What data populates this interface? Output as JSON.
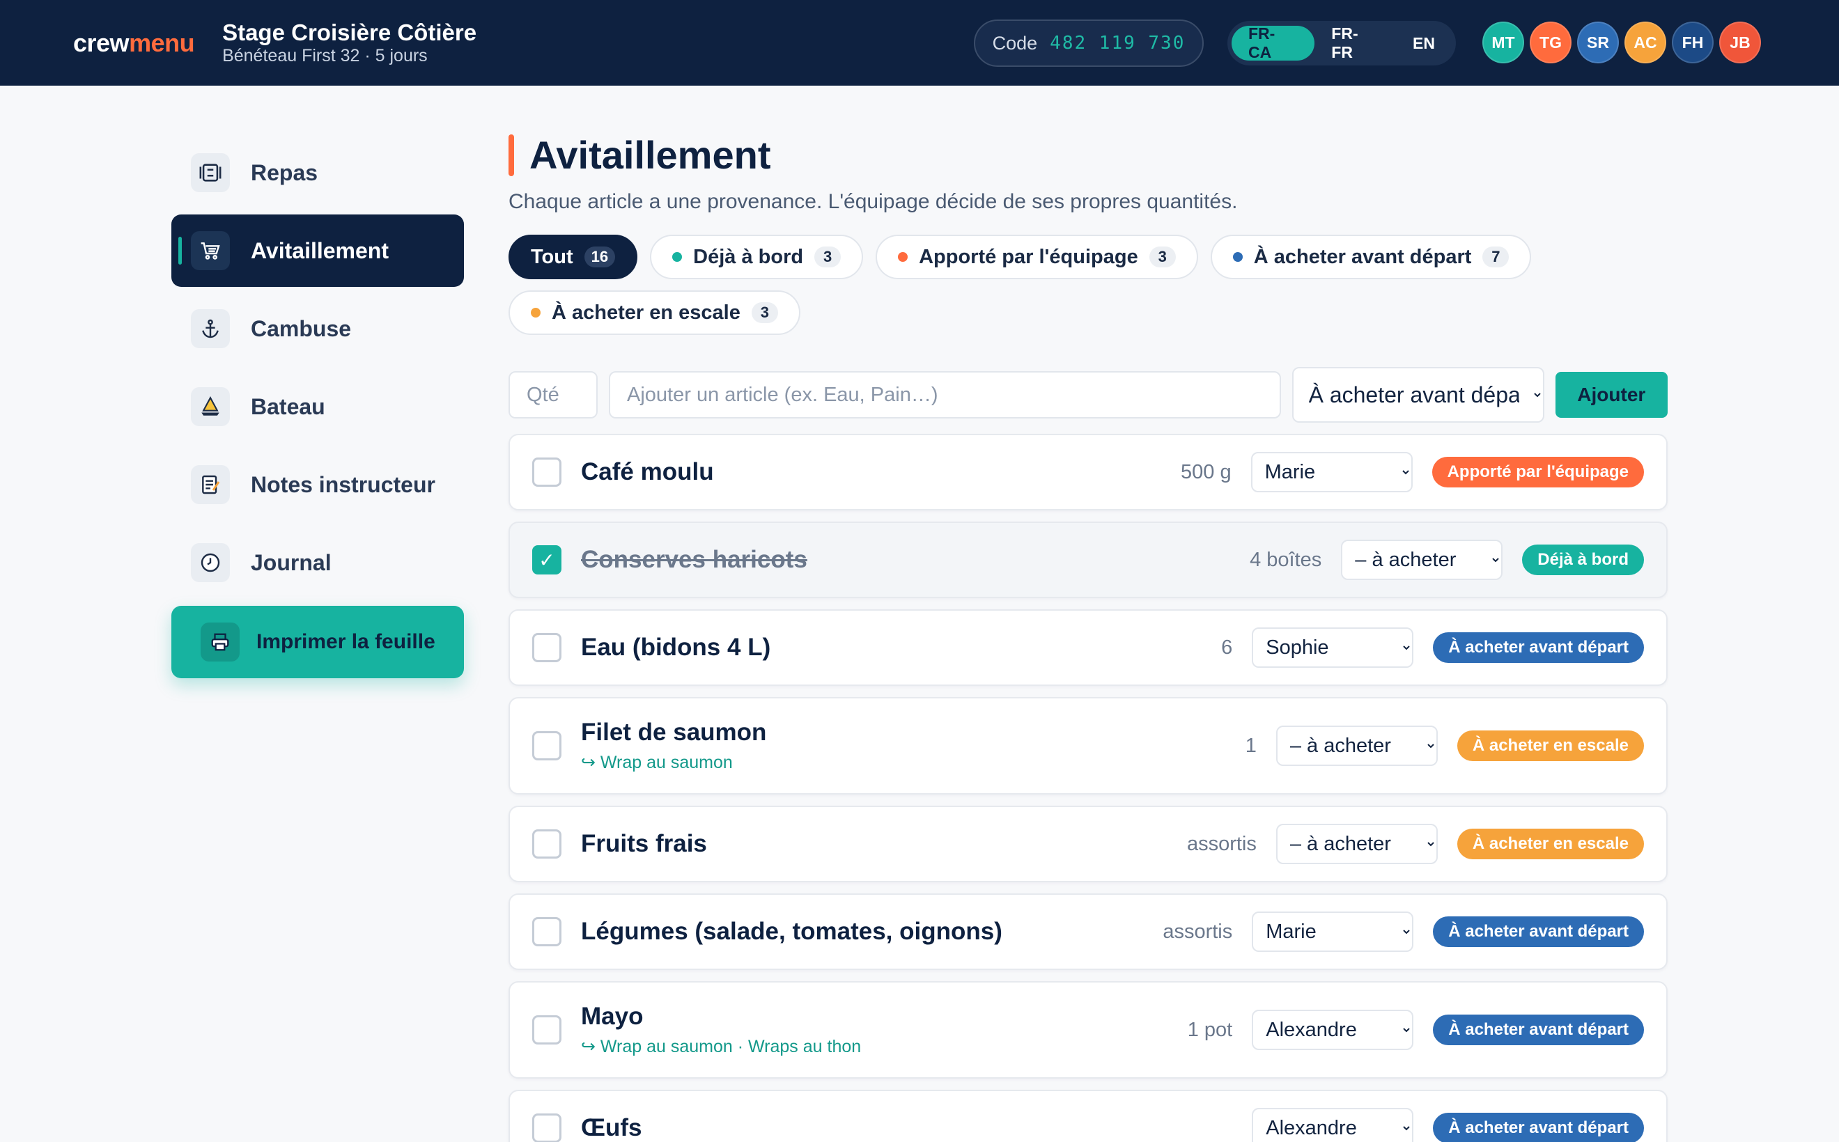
{
  "brand": {
    "logo_part1": "crew",
    "logo_part2": "menu"
  },
  "trip": {
    "title": "Stage Croisière Côtière",
    "subtitle": "Bénéteau First 32 · 5 jours"
  },
  "code": {
    "label": "Code",
    "value": "482 119 730"
  },
  "languages": [
    {
      "label": "FR-CA",
      "active": true
    },
    {
      "label": "FR-FR",
      "active": false
    },
    {
      "label": "EN",
      "active": false
    }
  ],
  "avatars": [
    {
      "initials": "MT",
      "color": "#17b3a0"
    },
    {
      "initials": "TG",
      "color": "#ff6b3d"
    },
    {
      "initials": "SR",
      "color": "#2d6cb5"
    },
    {
      "initials": "AC",
      "color": "#f6a33b"
    },
    {
      "initials": "FH",
      "color": "#1c4a86"
    },
    {
      "initials": "JB",
      "color": "#f0563a"
    }
  ],
  "sidebar": {
    "items": [
      {
        "label": "Repas",
        "icon": "meal-icon"
      },
      {
        "label": "Avitaillement",
        "icon": "cart-icon",
        "active": true
      },
      {
        "label": "Cambuse",
        "icon": "anchor-icon"
      },
      {
        "label": "Bateau",
        "icon": "sailboat-icon"
      },
      {
        "label": "Notes instructeur",
        "icon": "notes-icon"
      },
      {
        "label": "Journal",
        "icon": "clock-icon"
      }
    ],
    "print_label": "Imprimer la feuille"
  },
  "page": {
    "title": "Avitaillement",
    "subtitle": "Chaque article a une provenance. L'équipage décide de ses propres quantités."
  },
  "filters": [
    {
      "label": "Tout",
      "count": "16",
      "active": true
    },
    {
      "label": "Déjà à bord",
      "count": "3",
      "dot": "#17b3a0"
    },
    {
      "label": "Apporté par l'équipage",
      "count": "3",
      "dot": "#ff6b3d"
    },
    {
      "label": "À acheter avant départ",
      "count": "7",
      "dot": "#2d6cb5"
    },
    {
      "label": "À acheter en escale",
      "count": "3",
      "dot": "#f6a33b"
    }
  ],
  "add_form": {
    "qty_placeholder": "Qté",
    "name_placeholder": "Ajouter un article (ex. Eau, Pain…)",
    "source_selected": "À acheter avant départ",
    "add_label": "Ajouter"
  },
  "items": [
    {
      "name": "Café moulu",
      "qty": "500 g",
      "assignee": "Marie",
      "badge": "Apporté par l'équipage",
      "badge_color": "orange",
      "checked": false,
      "recipes": ""
    },
    {
      "name": "Conserves haricots",
      "qty": "4 boîtes",
      "assignee": "– à acheter",
      "badge": "Déjà à bord",
      "badge_color": "teal",
      "checked": true,
      "recipes": ""
    },
    {
      "name": "Eau (bidons 4 L)",
      "qty": "6",
      "assignee": "Sophie",
      "badge": "À acheter avant départ",
      "badge_color": "blue",
      "checked": false,
      "recipes": ""
    },
    {
      "name": "Filet de saumon",
      "qty": "1",
      "assignee": "– à acheter",
      "badge": "À acheter en escale",
      "badge_color": "amber",
      "checked": false,
      "recipes": "↪ Wrap au saumon"
    },
    {
      "name": "Fruits frais",
      "qty": "assortis",
      "assignee": "– à acheter",
      "badge": "À acheter en escale",
      "badge_color": "amber",
      "checked": false,
      "recipes": ""
    },
    {
      "name": "Légumes (salade, tomates, oignons)",
      "qty": "assortis",
      "assignee": "Marie",
      "badge": "À acheter avant départ",
      "badge_color": "blue",
      "checked": false,
      "recipes": ""
    },
    {
      "name": "Mayo",
      "qty": "1 pot",
      "assignee": "Alexandre",
      "badge": "À acheter avant départ",
      "badge_color": "blue",
      "checked": false,
      "recipes": "↪ Wrap au saumon · Wraps au thon"
    },
    {
      "name": "Œufs",
      "qty": "",
      "assignee": "Alexandre",
      "badge": "À acheter avant départ",
      "badge_color": "blue",
      "checked": false,
      "recipes": ""
    }
  ],
  "icons": {
    "check": "✓",
    "chevron": "chevron-down-icon"
  }
}
